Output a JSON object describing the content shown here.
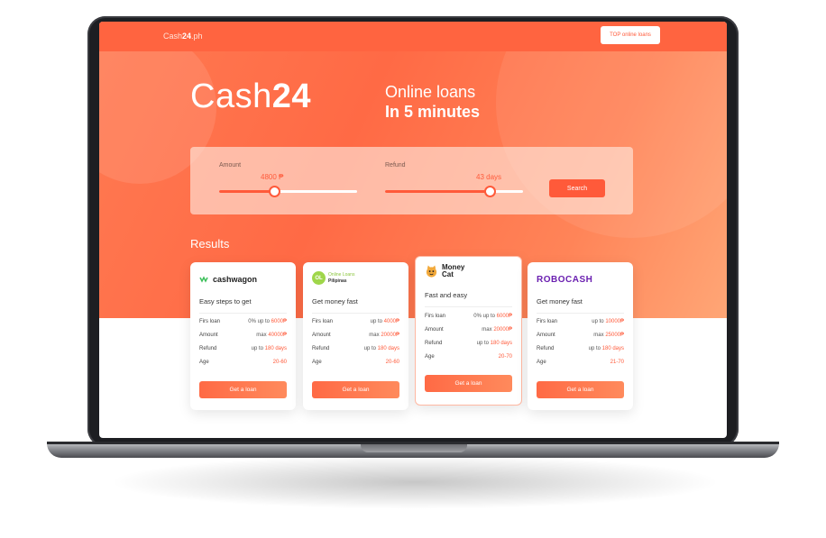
{
  "header": {
    "brand_pre": "Cash",
    "brand_bold": "24",
    "brand_suffix": ".ph",
    "top_button": "TOP online loans"
  },
  "hero": {
    "logo_pre": "Cash",
    "logo_bold": "24",
    "tagline1": "Online loans",
    "tagline2": "In 5 minutes"
  },
  "filter": {
    "amount_label": "Amount",
    "amount_value": "4800 ₱",
    "amount_fraction": 0.4,
    "refund_label": "Refund",
    "refund_value": "43 days",
    "refund_fraction": 0.76,
    "search_button": "Search"
  },
  "results_title": "Results",
  "row_labels": {
    "loan": "Firs loan",
    "amount": "Amount",
    "refund": "Refund",
    "age": "Age"
  },
  "cards": [
    {
      "logo": "cashwagon",
      "tagline": "Easy steps to get",
      "loan_pre": "0% up to ",
      "loan_val": "6000₱",
      "amount_pre": "max ",
      "amount_val": "40000₱",
      "refund_pre": "up to ",
      "refund_val": "180 days",
      "age_val": "20-60",
      "button": "Get a loan"
    },
    {
      "logo_mark": "OL",
      "logo_line1": "Online Loans",
      "logo_line2": "Pilipinas",
      "tagline": "Get money fast",
      "loan_pre": "up to ",
      "loan_val": "4000₱",
      "amount_pre": "max ",
      "amount_val": "20000₱",
      "refund_pre": "up to ",
      "refund_val": "180 days",
      "age_val": "20-60",
      "button": "Get a loan"
    },
    {
      "logo_line1": "Money",
      "logo_line2": "Cat",
      "tagline": "Fast and easy",
      "loan_pre": "0% up to ",
      "loan_val": "6000₱",
      "amount_pre": "max ",
      "amount_val": "20000₱",
      "refund_pre": "up to ",
      "refund_val": "180 days",
      "age_val": "20-70",
      "button": "Get a loan"
    },
    {
      "logo": "ROBOCASH",
      "tagline": "Get money fast",
      "loan_pre": "up to ",
      "loan_val": "10000₱",
      "amount_pre": "max ",
      "amount_val": "25000₱",
      "refund_pre": "up to ",
      "refund_val": "180 days",
      "age_val": "21-70",
      "button": "Get a loan"
    }
  ],
  "colors": {
    "accent": "#ff5a3a",
    "hero_start": "#ff6a45",
    "hero_end": "#ffa676",
    "robocash": "#6a1fb0"
  },
  "icons": [
    "cashwagon-logo-icon",
    "online-loans-logo-icon",
    "money-cat-logo-icon"
  ]
}
